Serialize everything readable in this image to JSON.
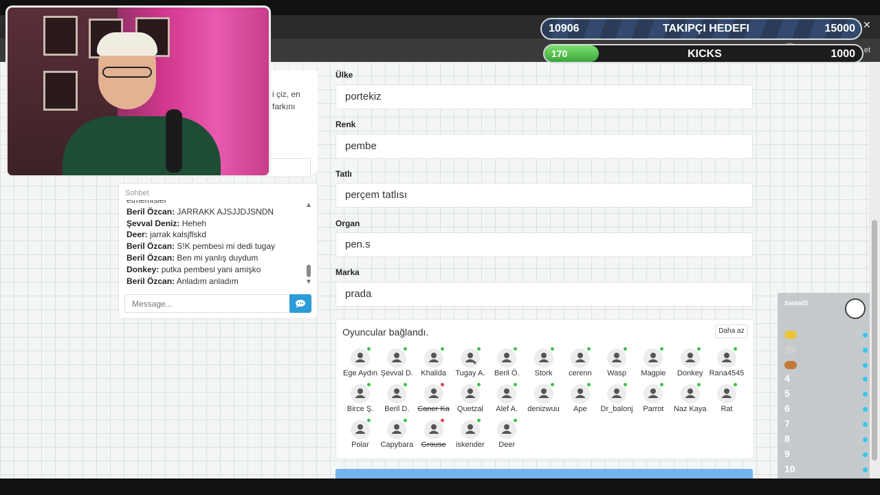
{
  "stream_overlay": {
    "follower_goal": {
      "current": "10906",
      "label": "TAKIPÇI HEDEFI",
      "target": "15000"
    },
    "kicks_goal": {
      "current": "170",
      "label": "KICKS",
      "target": "1000",
      "progress": 0.17
    },
    "close_symbol": "✕"
  },
  "browser": {
    "sohbet_button": "Sohbet et"
  },
  "info_panel": {
    "line1": "i çiz, en",
    "line2": "farkını"
  },
  "chat": {
    "title": "Sohbet",
    "partial_top": "etmemisler",
    "messages": [
      {
        "user": "Beril Özcan:",
        "text": "JARRAKK AJSJJDJSNDN"
      },
      {
        "user": "Şevval Deniz:",
        "text": "Heheh"
      },
      {
        "user": "Deer:",
        "text": "jarrak kalsjflskd"
      },
      {
        "user": "Beril Özcan:",
        "text": "S!K pembesi mi dedi tugay"
      },
      {
        "user": "Beril Özcan:",
        "text": "Ben mi yanlış duydum"
      },
      {
        "user": "Donkey:",
        "text": "putka pembesi yani amişko"
      },
      {
        "user": "Beril Özcan:",
        "text": "Anladım anladım"
      }
    ],
    "input_placeholder": "Message..."
  },
  "form": {
    "fields": [
      {
        "label": "Ülke",
        "value": "portekiz"
      },
      {
        "label": "Renk",
        "value": "pembe"
      },
      {
        "label": "Tatlı",
        "value": "perçem tatlısı"
      },
      {
        "label": "Organ",
        "value": "pen.s"
      },
      {
        "label": "Marka",
        "value": "prada"
      }
    ]
  },
  "players": {
    "status": "Oyuncular bağlandı.",
    "toggle_label": "Daha az",
    "online_color": "#3cc24a",
    "offline_color": "#e0454a",
    "list": [
      {
        "name": "Ege Aydın",
        "status": "online"
      },
      {
        "name": "Şevval D.",
        "status": "online"
      },
      {
        "name": "Khalida",
        "status": "online"
      },
      {
        "name": "Tugay A.",
        "status": "online",
        "host": true
      },
      {
        "name": "Beril Ö.",
        "status": "online"
      },
      {
        "name": "Stork",
        "status": "online"
      },
      {
        "name": "cerenn",
        "status": "online"
      },
      {
        "name": "Wasp",
        "status": "online"
      },
      {
        "name": "Magpie",
        "status": "online"
      },
      {
        "name": "Donkey",
        "status": "online"
      },
      {
        "name": "Rana4545",
        "status": "online"
      },
      {
        "name": "Birce Ş.",
        "status": "online"
      },
      {
        "name": "Beril D.",
        "status": "online"
      },
      {
        "name": "Caner Ka",
        "status": "offline"
      },
      {
        "name": "Quetzal",
        "status": "online"
      },
      {
        "name": "Alef A.",
        "status": "online"
      },
      {
        "name": "denizwuu",
        "status": "online"
      },
      {
        "name": "Ape",
        "status": "online"
      },
      {
        "name": "Dr_balonj",
        "status": "online"
      },
      {
        "name": "Parrot",
        "status": "online"
      },
      {
        "name": "Naz Kaya",
        "status": "online"
      },
      {
        "name": "Rat",
        "status": "online"
      },
      {
        "name": "Polar",
        "status": "online"
      },
      {
        "name": "Capybara",
        "status": "online"
      },
      {
        "name": "Grouse",
        "status": "offline"
      },
      {
        "name": "iskender",
        "status": "online"
      },
      {
        "name": "Deer",
        "status": "online"
      }
    ]
  },
  "leaderboard": {
    "title": "Saida03",
    "ranks": [
      "4",
      "5",
      "6",
      "7",
      "8",
      "9",
      "10"
    ]
  }
}
